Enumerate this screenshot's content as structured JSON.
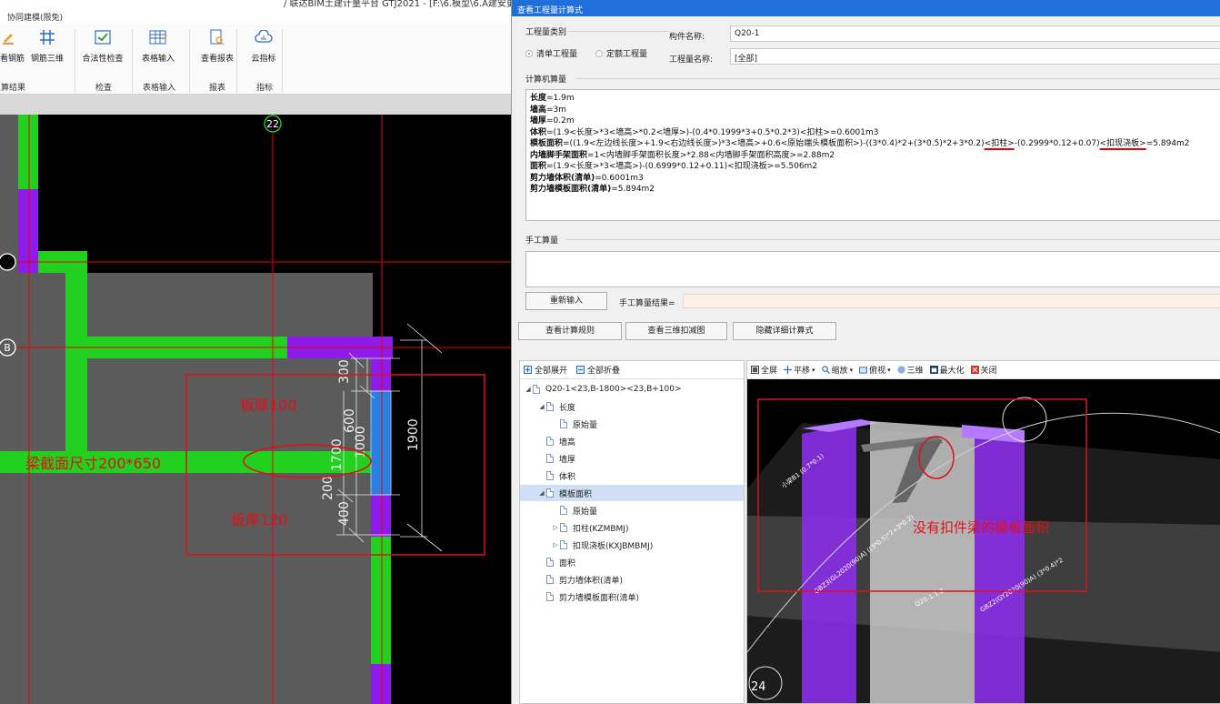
{
  "left_app": {
    "title_fragment": "/ 联达BIM土建计量平台 GTJ2021 - [F:\\6.模型\\6.A建安更",
    "collab_tab": "协同建模(限免)",
    "ribbon": {
      "buttons": [
        {
          "label": "查看钢筋",
          "icon": "pencil-icon"
        },
        {
          "label": "钢筋三维",
          "icon": "rebar-3d-icon"
        },
        {
          "label": "合法性检查",
          "icon": "check-icon"
        },
        {
          "label": "表格输入",
          "icon": "table-icon"
        },
        {
          "label": "查看报表",
          "icon": "report-icon"
        },
        {
          "label": "云指标",
          "icon": "cloud-icon"
        }
      ],
      "groups": [
        "土算结果",
        "检查",
        "表格输入",
        "报表",
        "指标"
      ]
    },
    "cad": {
      "axis_labels": [
        "22",
        "B"
      ],
      "dimensions": [
        "300",
        "600",
        "1000",
        "1700",
        "200",
        "400",
        "1900"
      ],
      "annotations": {
        "slab_100": "板厚100",
        "beam_section": "梁截面尺寸200*650",
        "slab_120": "板厚120"
      }
    }
  },
  "dialog": {
    "title": "查看工程量计算式",
    "qty_category_label": "工程量类别",
    "radio_list": "清单工程量",
    "radio_quota": "定额工程量",
    "component_name_label": "构件名称:",
    "component_name_value": "Q20-1",
    "qty_name_label": "工程量名称:",
    "qty_name_value": "[全部]",
    "machine_calc_label": "计算机算量",
    "calc_lines": [
      {
        "key": "长度",
        "rest": "=1.9m"
      },
      {
        "key": "墙高",
        "rest": "=3m"
      },
      {
        "key": "墙厚",
        "rest": "=0.2m"
      },
      {
        "key": "体积",
        "rest": "=(1.9<长度>*3<墙高>*0.2<墙厚>)-(0.4*0.1999*3+0.5*0.2*3)<扣柱>=0.6001m3"
      },
      {
        "key": "模板面积",
        "rest_a": "=((1.9<左边线长度>+1.9<右边线长度>)*3<墙高>+0.6<原始端头模板面积>)-((3*0.4)*2+(3*0.5)*2+3*0.2)",
        "ul1": "<扣柱>",
        "rest_b": "-(0.2999*0.12+0.07)",
        "ul2": "<扣现浇板>",
        "rest_c": "=5.894m2"
      },
      {
        "key": "内墙脚手架面积",
        "rest": "=1<内墙脚手架面积长度>*2.88<内墙脚手架面积高度>=2.88m2"
      },
      {
        "key": "面积",
        "rest": "=(1.9<长度>*3<墙高>)-(0.6999*0.12+0.11)<扣现浇板>=5.506m2"
      },
      {
        "key": "剪力墙体积(清单)",
        "rest": "=0.6001m3"
      },
      {
        "key": "剪力墙模板面积(清单)",
        "rest": "=5.894m2"
      }
    ],
    "manual_calc_label": "手工算量",
    "reinput_button": "重新输入",
    "manual_result_label": "手工算量结果=",
    "rules_button": "查看计算规则",
    "view3d_button": "查看三维扣减图",
    "hide_button": "隐藏详细计算式",
    "tree_toolbar": {
      "expand_all": "全部展开",
      "collapse_all": "全部折叠"
    },
    "tree": [
      {
        "label": "Q20-1<23,B-1800><23,B+100>",
        "level": 0,
        "arrow": "◢"
      },
      {
        "label": "长度",
        "level": 1,
        "arrow": "◢"
      },
      {
        "label": "原始量",
        "level": 2,
        "arrow": ""
      },
      {
        "label": "墙高",
        "level": 1,
        "arrow": ""
      },
      {
        "label": "墙厚",
        "level": 1,
        "arrow": ""
      },
      {
        "label": "体积",
        "level": 1,
        "arrow": ""
      },
      {
        "label": "模板面积",
        "level": 1,
        "arrow": "◢",
        "selected": true
      },
      {
        "label": "原始量",
        "level": 2,
        "arrow": ""
      },
      {
        "label": "扣柱(KZMBMJ)",
        "level": 2,
        "arrow": "▷"
      },
      {
        "label": "扣现浇板(KXJBMBMJ)",
        "level": 2,
        "arrow": "▷"
      },
      {
        "label": "面积",
        "level": 1,
        "arrow": ""
      },
      {
        "label": "剪力墙体积(清单)",
        "level": 1,
        "arrow": ""
      },
      {
        "label": "剪力墙模板面积(清单)",
        "level": 1,
        "arrow": ""
      }
    ],
    "view_toolbar": [
      "全屏",
      "平移",
      "缩放",
      "俯视",
      "三维",
      "最大化",
      "关闭"
    ],
    "view3d": {
      "labels": {
        "beam": "小梁B1 (0.7*0.1)",
        "col1": "GBZ3(GL2020(90)A) ((3*0.5)*2+3*0.2)",
        "wall": "Q20-1.1.2",
        "col2": "GBZ2(GY2020(90)A) (3*0.4)*2",
        "axis24": "24"
      },
      "annotation": "没有扣件梁的模板面积"
    }
  },
  "colors": {
    "accent_blue": "#1e6fd9",
    "cad_green": "#22d11f",
    "cad_purple": "#8e1ce8",
    "annotation_red": "#e0101a",
    "slab_gray": "#5b5b5b"
  }
}
